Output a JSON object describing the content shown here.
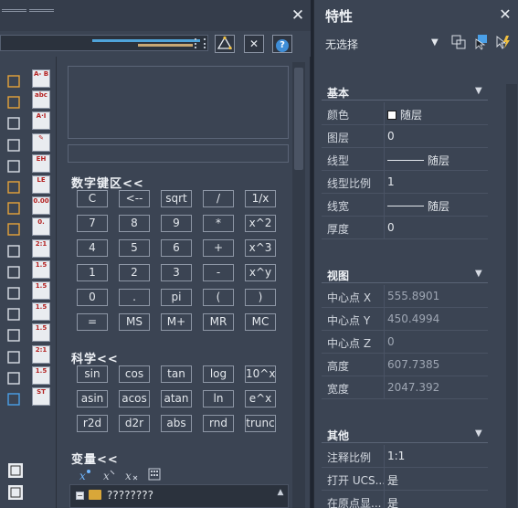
{
  "calc": {
    "close_glyph": "✕",
    "toolbar": {
      "get_coords_icon": "measure-icon",
      "clear_glyph": "✕",
      "help_glyph": "?"
    },
    "numpad_title": "数字键区<<",
    "numpad_keys": [
      [
        "C",
        "<--",
        "sqrt",
        "/",
        "1/x"
      ],
      [
        "7",
        "8",
        "9",
        "*",
        "x^2"
      ],
      [
        "4",
        "5",
        "6",
        "+",
        "x^3"
      ],
      [
        "1",
        "2",
        "3",
        "-",
        "x^y"
      ],
      [
        "0",
        ".",
        "pi",
        "(",
        ")"
      ],
      [
        "=",
        "MS",
        "M+",
        "MR",
        "MC"
      ]
    ],
    "sci_title": "科学<<",
    "sci_keys": [
      [
        "sin",
        "cos",
        "tan",
        "log",
        "10^x"
      ],
      [
        "asin",
        "acos",
        "atan",
        "ln",
        "e^x"
      ],
      [
        "r2d",
        "d2r",
        "abs",
        "rnd",
        "trunc"
      ]
    ],
    "var_title": "变量<<",
    "var_tree_toggle": "−",
    "var_folder_label": "????????",
    "tool_labels": [
      "A-\nB",
      "abc",
      "A·I",
      "✎",
      "EH",
      "LE",
      "0.00",
      "0.",
      "2:1",
      "1.5",
      "1.5",
      "1.5",
      "1.5",
      "2:1",
      "1.5",
      "ST"
    ]
  },
  "properties": {
    "title": "特性",
    "close_glyph": "✕",
    "selection_value": "无选择",
    "groups": [
      {
        "title": "基本",
        "rows": [
          {
            "key": "颜色",
            "value": "随层",
            "kind": "color"
          },
          {
            "key": "图层",
            "value": "0",
            "kind": "text"
          },
          {
            "key": "线型",
            "value": "随层",
            "kind": "line"
          },
          {
            "key": "线型比例",
            "value": "1",
            "kind": "text"
          },
          {
            "key": "线宽",
            "value": "随层",
            "kind": "line"
          },
          {
            "key": "厚度",
            "value": "0",
            "kind": "text"
          }
        ]
      },
      {
        "title": "视图",
        "rows": [
          {
            "key": "中心点 X",
            "value": "555.8901",
            "kind": "dim"
          },
          {
            "key": "中心点 Y",
            "value": "450.4994",
            "kind": "dim"
          },
          {
            "key": "中心点 Z",
            "value": "0",
            "kind": "dim"
          },
          {
            "key": "高度",
            "value": "607.7385",
            "kind": "dim"
          },
          {
            "key": "宽度",
            "value": "2047.392",
            "kind": "dim"
          }
        ]
      },
      {
        "title": "其他",
        "rows": [
          {
            "key": "注释比例",
            "value": "1:1",
            "kind": "text"
          },
          {
            "key": "打开 UCS...",
            "value": "是",
            "kind": "text"
          },
          {
            "key": "在原点显...",
            "value": "是",
            "kind": "text"
          }
        ]
      }
    ]
  }
}
